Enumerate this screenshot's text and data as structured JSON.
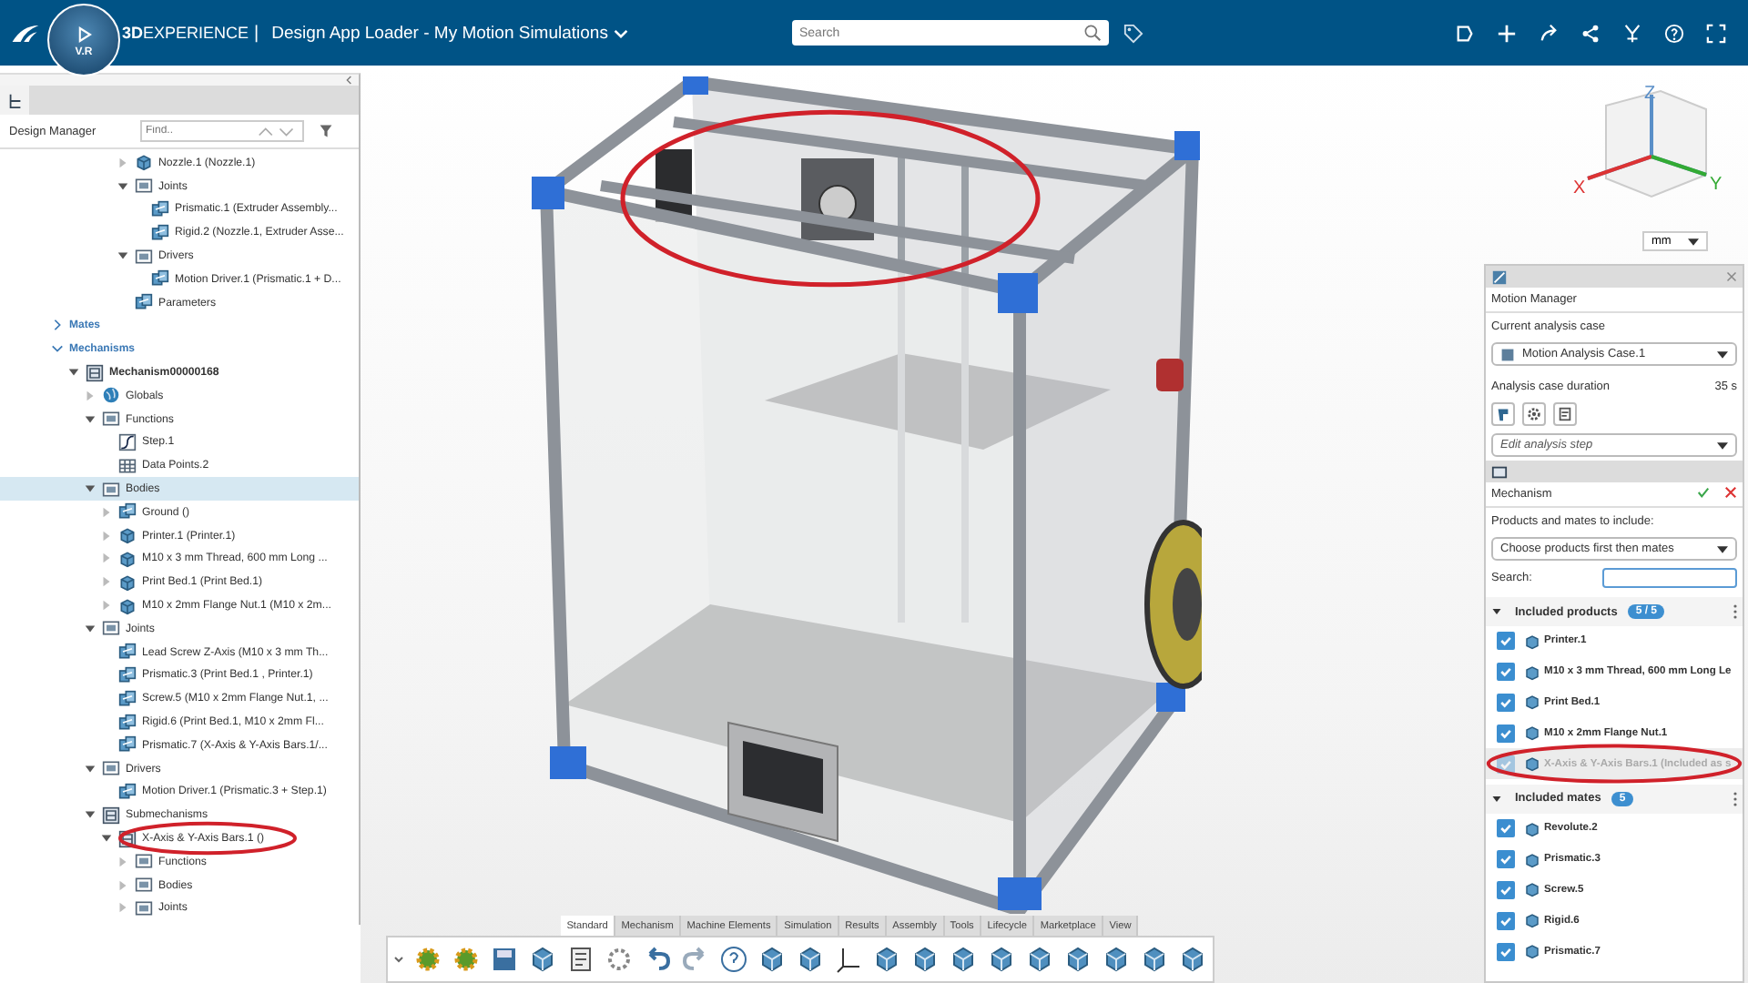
{
  "top_bar": {
    "compass_label": "V.R",
    "title": "**3D**EXPERIENCE",
    "separator": "|",
    "app_title": "Design App Loader - My Motion Simulations",
    "search": {
      "placeholder": "Search"
    }
  },
  "design_manager": {
    "title": "Design Manager",
    "find": {
      "placeholder": "Find.."
    },
    "tree_top": [
      {
        "label": "Nozzle.1 (Nozzle.1)",
        "kind": "part",
        "expanded": false,
        "selected": false
      },
      {
        "label": "Joints",
        "kind": "folder",
        "expanded": true,
        "selected": false,
        "children": [
          {
            "label": "Prismatic.1 (Extruder Assembly...",
            "kind": "item",
            "selected": false
          },
          {
            "label": "Rigid.2 (Nozzle.1, Extruder Asse...",
            "kind": "item",
            "selected": false
          }
        ]
      },
      {
        "label": "Drivers",
        "kind": "folder",
        "expanded": true,
        "selected": false,
        "children": [
          {
            "label": "Motion Driver.1 (Prismatic.1 + D...",
            "kind": "item",
            "selected": false
          }
        ]
      },
      {
        "label": "Parameters",
        "kind": "item",
        "selected": false
      }
    ],
    "tree": [
      {
        "label": "Mates",
        "kind": "section",
        "expanded": false,
        "selected": false
      },
      {
        "label": "Mechanisms",
        "kind": "section",
        "expanded": true,
        "selected": false,
        "children": [
          {
            "label": "Mechanism00000168",
            "kind": "mechanism",
            "expanded": true,
            "selected": false,
            "children": [
              {
                "label": "Globals",
                "kind": "globe",
                "expanded": false,
                "selected": false
              },
              {
                "label": "Functions",
                "kind": "folder",
                "expanded": true,
                "selected": false,
                "children": [
                  {
                    "label": "Step.1",
                    "kind": "curve",
                    "selected": false
                  },
                  {
                    "label": "Data Points.2",
                    "kind": "grid",
                    "selected": false
                  }
                ]
              },
              {
                "label": "Bodies",
                "kind": "folder",
                "expanded": true,
                "selected": true,
                "children": [
                  {
                    "label": "Ground ()",
                    "kind": "item",
                    "expanded": false,
                    "selected": false
                  },
                  {
                    "label": "Printer.1 (Printer.1)",
                    "kind": "part",
                    "expanded": false,
                    "selected": false
                  },
                  {
                    "label": "M10 x 3 mm Thread, 600 mm Long ...",
                    "kind": "part",
                    "expanded": false,
                    "selected": false
                  },
                  {
                    "label": "Print Bed.1 (Print Bed.1)",
                    "kind": "part",
                    "expanded": false,
                    "selected": false
                  },
                  {
                    "label": "M10 x 2mm Flange Nut.1 (M10 x 2m...",
                    "kind": "part",
                    "expanded": false,
                    "selected": false
                  }
                ]
              },
              {
                "label": "Joints",
                "kind": "folder",
                "expanded": true,
                "selected": false,
                "children": [
                  {
                    "label": "Lead Screw Z-Axis (M10 x 3 mm Th...",
                    "kind": "item",
                    "selected": false
                  },
                  {
                    "label": "Prismatic.3 (Print Bed.1 , Printer.1)",
                    "kind": "item",
                    "selected": false
                  },
                  {
                    "label": "Screw.5 (M10 x 2mm Flange Nut.1, ...",
                    "kind": "item",
                    "selected": false
                  },
                  {
                    "label": "Rigid.6 (Print Bed.1, M10 x 2mm Fl...",
                    "kind": "item",
                    "selected": false
                  },
                  {
                    "label": "Prismatic.7 (X-Axis & Y-Axis Bars.1/...",
                    "kind": "item",
                    "selected": false
                  }
                ]
              },
              {
                "label": "Drivers",
                "kind": "folder",
                "expanded": true,
                "selected": false,
                "children": [
                  {
                    "label": "Motion Driver.1 (Prismatic.3 + Step.1)",
                    "kind": "item",
                    "selected": false
                  }
                ]
              },
              {
                "label": "Submechanisms",
                "kind": "mechanism-folder",
                "expanded": true,
                "selected": false,
                "children": [
                  {
                    "label": "X-Axis & Y-Axis Bars.1 ()",
                    "kind": "mechanism-folder",
                    "expanded": true,
                    "selected": false,
                    "circled": true,
                    "children": [
                      {
                        "label": "Functions",
                        "kind": "folder",
                        "expanded": false,
                        "selected": false
                      },
                      {
                        "label": "Bodies",
                        "kind": "folder",
                        "expanded": false,
                        "selected": false
                      },
                      {
                        "label": "Joints",
                        "kind": "folder",
                        "expanded": false,
                        "selected": false
                      }
                    ]
                  }
                ]
              }
            ]
          }
        ]
      }
    ]
  },
  "view_cube": {
    "axes": [
      "X",
      "Y",
      "Z"
    ]
  },
  "units": "mm",
  "motion_manager": {
    "title": "Motion Manager",
    "case_label": "Current analysis case",
    "case_value": "Motion Analysis Case.1",
    "duration_label": "Analysis case duration",
    "duration_value": "35 s",
    "step": {
      "placeholder": "Edit analysis step"
    }
  },
  "mechanism_panel": {
    "title": "Mechanism",
    "include_label": "Products and mates to include:",
    "include_value": "Choose products first then mates",
    "search_label": "Search:",
    "groups": [
      {
        "title": "Included products",
        "count": "5 / 5",
        "expanded": true,
        "items": [
          {
            "label": "Printer.1",
            "checked": true,
            "disabled": false
          },
          {
            "label": "M10 x 3 mm Thread, 600 mm Long Le",
            "checked": true,
            "disabled": false
          },
          {
            "label": "Print Bed.1",
            "checked": true,
            "disabled": false
          },
          {
            "label": "M10 x 2mm Flange Nut.1",
            "checked": true,
            "disabled": false
          },
          {
            "label": "X-Axis & Y-Axis Bars.1 (Included as s",
            "checked": true,
            "disabled": true,
            "circled": true
          }
        ]
      },
      {
        "title": "Included mates",
        "count": "5",
        "expanded": true,
        "items": [
          {
            "label": "Revolute.2",
            "checked": true,
            "disabled": false
          },
          {
            "label": "Prismatic.3",
            "checked": true,
            "disabled": false
          },
          {
            "label": "Screw.5",
            "checked": true,
            "disabled": false
          },
          {
            "label": "Rigid.6",
            "checked": true,
            "disabled": false
          },
          {
            "label": "Prismatic.7",
            "checked": true,
            "disabled": false
          }
        ]
      }
    ]
  },
  "tabs": [
    {
      "label": "Standard",
      "selected": true
    },
    {
      "label": "Mechanism",
      "selected": false
    },
    {
      "label": "Machine Elements",
      "selected": false
    },
    {
      "label": "Simulation",
      "selected": false
    },
    {
      "label": "Results",
      "selected": false
    },
    {
      "label": "Assembly",
      "selected": false
    },
    {
      "label": "Tools",
      "selected": false
    },
    {
      "label": "Lifecycle",
      "selected": false
    },
    {
      "label": "Marketplace",
      "selected": false
    },
    {
      "label": "View",
      "selected": false
    }
  ]
}
